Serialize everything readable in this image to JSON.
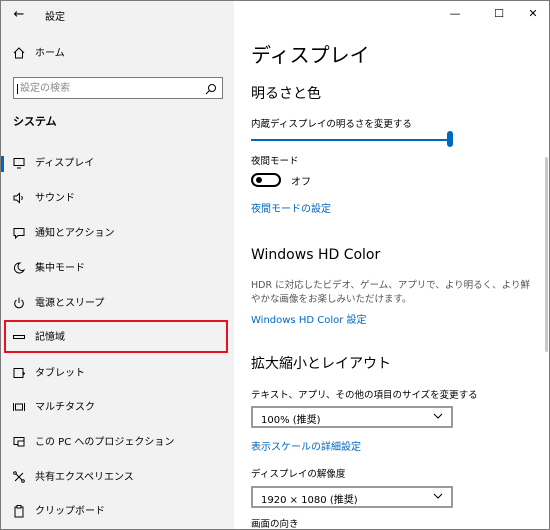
{
  "window": {
    "title": "設定",
    "controls": [
      "—",
      "☐",
      "✕"
    ]
  },
  "sidebar": {
    "home_label": "ホーム",
    "search_placeholder": "設定の検索",
    "section": "システム",
    "items": [
      {
        "label": "ディスプレイ",
        "icon": "monitor-icon",
        "active": true
      },
      {
        "label": "サウンド",
        "icon": "speaker-icon"
      },
      {
        "label": "通知とアクション",
        "icon": "notification-icon"
      },
      {
        "label": "集中モード",
        "icon": "moon-icon"
      },
      {
        "label": "電源とスリープ",
        "icon": "power-icon"
      },
      {
        "label": "記憶域",
        "icon": "storage-icon",
        "highlighted": true
      },
      {
        "label": "タブレット",
        "icon": "tablet-icon"
      },
      {
        "label": "マルチタスク",
        "icon": "multitask-icon"
      },
      {
        "label": "この PC へのプロジェクション",
        "icon": "projection-icon"
      },
      {
        "label": "共有エクスペリエンス",
        "icon": "shared-experience-icon"
      },
      {
        "label": "クリップボード",
        "icon": "clipboard-icon"
      }
    ]
  },
  "content": {
    "title": "ディスプレイ",
    "brightness": {
      "heading": "明るさと色",
      "slider_label": "内蔵ディスプレイの明るさを変更する",
      "level": 1.0
    },
    "night_light": {
      "label": "夜間モード",
      "state": "オフ",
      "settings_link": "夜間モードの設定"
    },
    "hd_color": {
      "heading": "Windows HD Color",
      "description": "HDR に対応したビデオ、ゲーム、アプリで、より明るく、より鮮やかな画像をお楽しみいただけます。",
      "link": "Windows HD Color 設定"
    },
    "scale_layout": {
      "heading": "拡大縮小とレイアウト",
      "scale_label": "テキスト、アプリ、その他の項目のサイズを変更する",
      "scale_value": "100% (推奨)",
      "advanced_link": "表示スケールの詳細設定",
      "resolution_label": "ディスプレイの解像度",
      "resolution_value": "1920 × 1080 (推奨)",
      "orientation_label": "画面の向き"
    }
  },
  "colors": {
    "accent": "#0067c0",
    "highlight": "#e81123",
    "sidebar_bg": "#f2f2f2"
  }
}
